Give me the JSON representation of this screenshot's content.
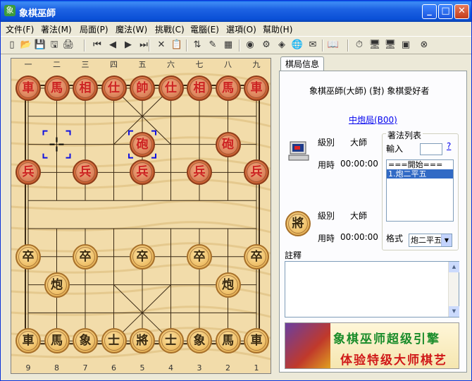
{
  "window": {
    "title": "象棋巫師",
    "min_glyph": "_",
    "max_glyph": "□",
    "close_glyph": "✕",
    "icon_glyph": "象"
  },
  "menu": [
    "文件(F)",
    "著法(M)",
    "局面(P)",
    "魔法(W)",
    "挑戰(C)",
    "電腦(E)",
    "選項(O)",
    "幫助(H)"
  ],
  "toolbar": {
    "icons": [
      "new-icon",
      "open-icon",
      "save-icon",
      "save-as-icon",
      "print-icon",
      "first-move-icon",
      "prev-move-icon",
      "next-move-icon",
      "last-move-icon",
      "delete-icon",
      "paste-icon",
      "flip-icon",
      "edit-icon",
      "grid-icon",
      "analyze-icon",
      "engine-icon",
      "record-icon",
      "web-icon",
      "note-icon",
      "book-icon",
      "clock-icon",
      "computer-red-icon",
      "computer-black-icon",
      "board-icon",
      "stop-icon"
    ],
    "glyphs": [
      "▯",
      "📂",
      "💾",
      "🖫",
      "🖨",
      "⏮",
      "◀",
      "▶",
      "⏭",
      "✕",
      "📋",
      "⇅",
      "✎",
      "▦",
      "◉",
      "⚙",
      "◈",
      "🌐",
      "✉",
      "📖",
      "⏱",
      "🖥",
      "🖥",
      "▣",
      "⊗"
    ]
  },
  "board": {
    "top_labels": [
      "一",
      "二",
      "三",
      "四",
      "五",
      "六",
      "七",
      "八",
      "九"
    ],
    "bottom_labels": [
      "9",
      "8",
      "7",
      "6",
      "5",
      "4",
      "3",
      "2",
      "1"
    ],
    "pieces": [
      {
        "t": "車",
        "c": "red",
        "f": 0,
        "r": 0
      },
      {
        "t": "馬",
        "c": "red",
        "f": 1,
        "r": 0
      },
      {
        "t": "相",
        "c": "red",
        "f": 2,
        "r": 0
      },
      {
        "t": "仕",
        "c": "red",
        "f": 3,
        "r": 0
      },
      {
        "t": "帥",
        "c": "red",
        "f": 4,
        "r": 0
      },
      {
        "t": "仕",
        "c": "red",
        "f": 5,
        "r": 0
      },
      {
        "t": "相",
        "c": "red",
        "f": 6,
        "r": 0
      },
      {
        "t": "馬",
        "c": "red",
        "f": 7,
        "r": 0
      },
      {
        "t": "車",
        "c": "red",
        "f": 8,
        "r": 0
      },
      {
        "t": "砲",
        "c": "red",
        "f": 4,
        "r": 2
      },
      {
        "t": "砲",
        "c": "red",
        "f": 7,
        "r": 2
      },
      {
        "t": "兵",
        "c": "red",
        "f": 0,
        "r": 3
      },
      {
        "t": "兵",
        "c": "red",
        "f": 2,
        "r": 3
      },
      {
        "t": "兵",
        "c": "red",
        "f": 4,
        "r": 3
      },
      {
        "t": "兵",
        "c": "red",
        "f": 6,
        "r": 3
      },
      {
        "t": "兵",
        "c": "red",
        "f": 8,
        "r": 3
      },
      {
        "t": "卒",
        "c": "black",
        "f": 0,
        "r": 6
      },
      {
        "t": "卒",
        "c": "black",
        "f": 2,
        "r": 6
      },
      {
        "t": "卒",
        "c": "black",
        "f": 4,
        "r": 6
      },
      {
        "t": "卒",
        "c": "black",
        "f": 6,
        "r": 6
      },
      {
        "t": "卒",
        "c": "black",
        "f": 8,
        "r": 6
      },
      {
        "t": "炮",
        "c": "black",
        "f": 1,
        "r": 7
      },
      {
        "t": "炮",
        "c": "black",
        "f": 7,
        "r": 7
      },
      {
        "t": "車",
        "c": "black",
        "f": 0,
        "r": 9
      },
      {
        "t": "馬",
        "c": "black",
        "f": 1,
        "r": 9
      },
      {
        "t": "象",
        "c": "black",
        "f": 2,
        "r": 9
      },
      {
        "t": "士",
        "c": "black",
        "f": 3,
        "r": 9
      },
      {
        "t": "將",
        "c": "black",
        "f": 4,
        "r": 9
      },
      {
        "t": "士",
        "c": "black",
        "f": 5,
        "r": 9
      },
      {
        "t": "象",
        "c": "black",
        "f": 6,
        "r": 9
      },
      {
        "t": "馬",
        "c": "black",
        "f": 7,
        "r": 9
      },
      {
        "t": "車",
        "c": "black",
        "f": 8,
        "r": 9
      }
    ],
    "selected_from": {
      "f": 1,
      "r": 2
    },
    "selected_to": {
      "f": 4,
      "r": 2
    }
  },
  "panel": {
    "tab": "棋局信息",
    "players": "象棋巫師(大師) (對) 象棋愛好者",
    "opening": "中炮局(B00)",
    "level_label": "級別",
    "level_value": "大師",
    "time_label": "用時",
    "time_value": "00:00:00",
    "level_label_2": "級別",
    "level_value_2": "大師",
    "time_label_2": "用時",
    "time_value_2": "00:00:00",
    "black_piece": "將",
    "moves_title": "著法列表",
    "input_label": "輸入",
    "help": "?",
    "move_list": [
      "===開始===",
      "1.炮二平五"
    ],
    "format_label": "格式",
    "format_value": "炮二平五",
    "comment_label": "註釋",
    "banner_line1": "象棋巫师超级引擎",
    "banner_line2": "体验特级大师棋艺"
  }
}
